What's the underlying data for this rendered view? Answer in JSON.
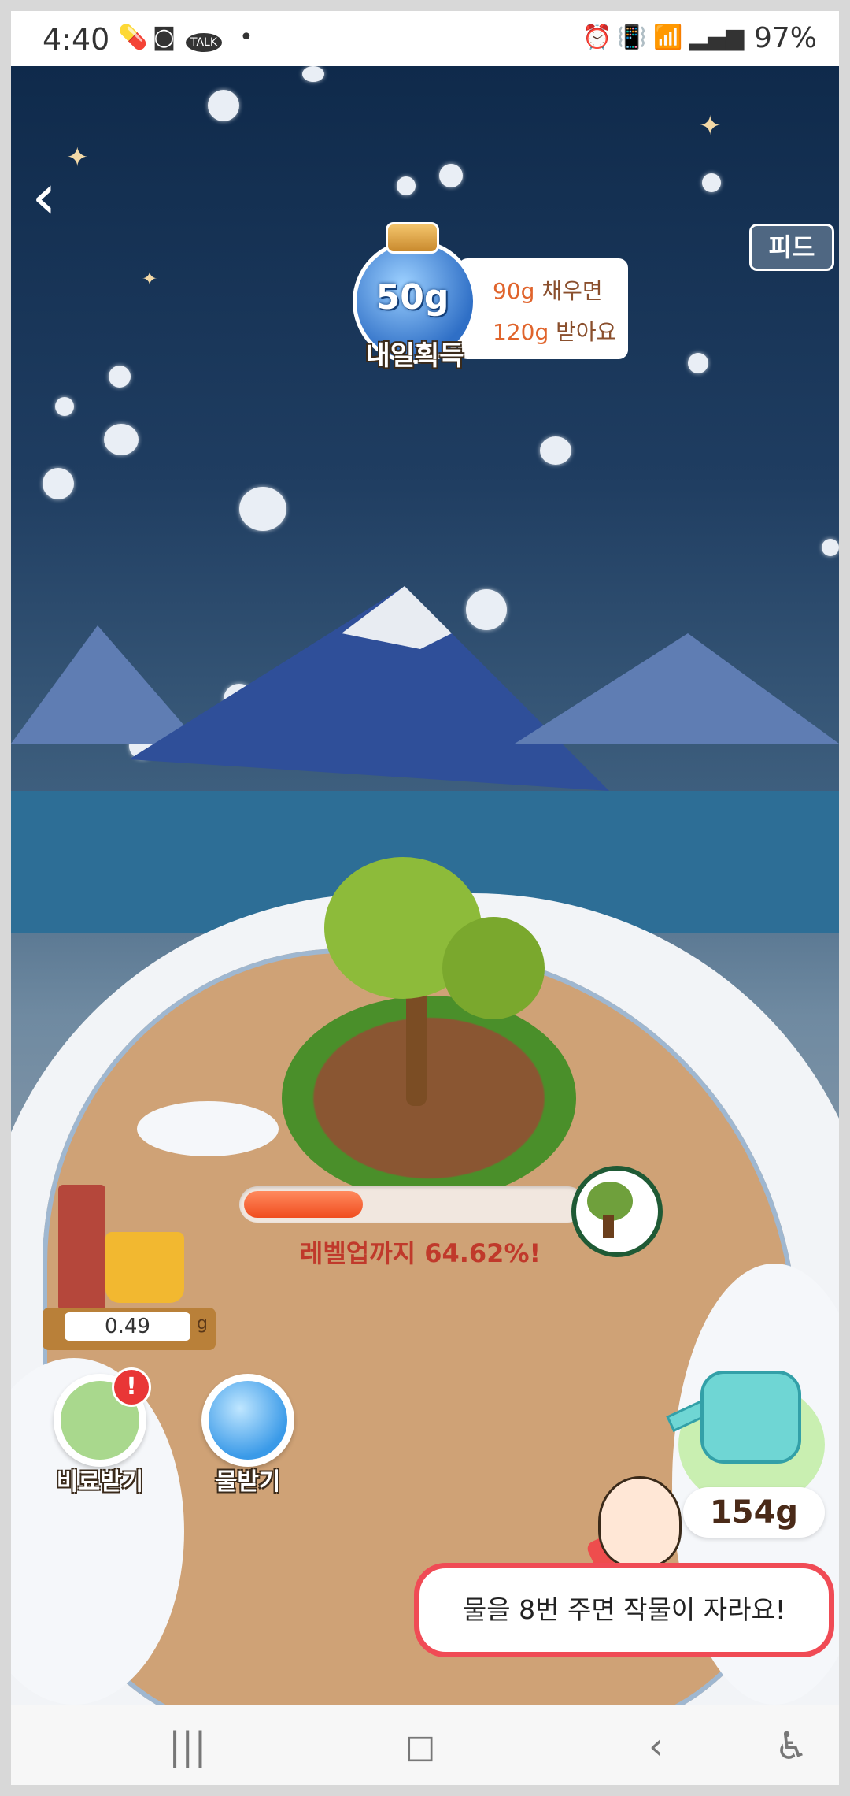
{
  "status_bar": {
    "time": "4:40",
    "battery": "97%",
    "icons": [
      "pill-icon",
      "app-icon",
      "talk-icon",
      "dot-icon",
      "alarm-icon",
      "vibrate-icon",
      "wifi-icon",
      "signal-icon",
      "battery-icon"
    ],
    "talk_label": "TALK"
  },
  "header": {
    "back_glyph": "‹",
    "feed_label": "피드"
  },
  "reward": {
    "amount": "50g",
    "label": "내일획득",
    "line1_value": "90g",
    "line1_text": "채우면",
    "line2_value": "120g",
    "line2_text": "받아요"
  },
  "plant": {
    "progress_text": "레벨업까지 64.62%!",
    "progress_fraction": 0.3535
  },
  "well": {
    "reading": "0.49",
    "unit": "g"
  },
  "actions": {
    "fertilizer_label": "비료받기",
    "fertilizer_badge": "!",
    "water_label": "물받기"
  },
  "watering": {
    "amount": "154g"
  },
  "hint": {
    "text": "물을 8번 주면 작물이 자라요!"
  },
  "nav": {
    "recent": "|||",
    "home": "◻",
    "back": "‹",
    "accessibility": "♿"
  },
  "colors": {
    "sky_top": "#0f2a4b",
    "accent_red": "#f04b55",
    "progress": "#f04d1f"
  }
}
